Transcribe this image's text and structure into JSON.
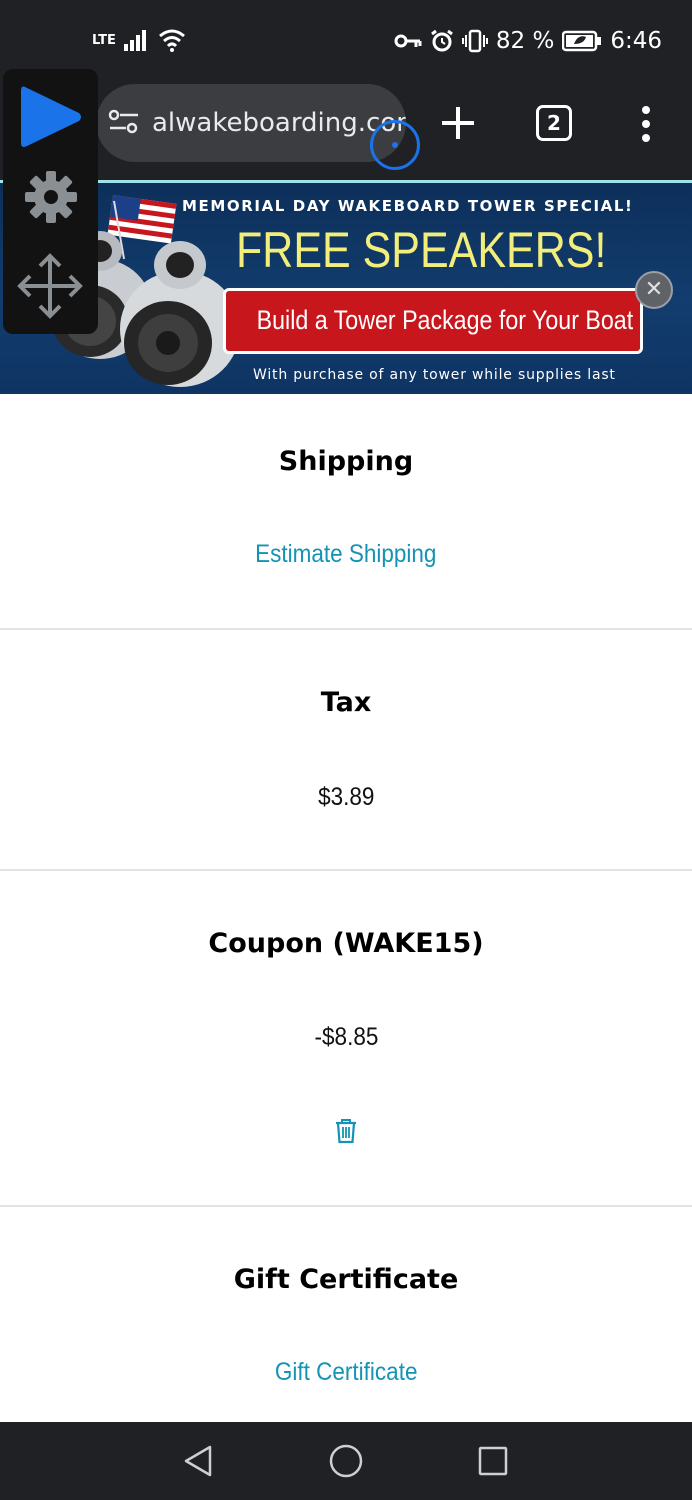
{
  "status_bar": {
    "network": "LTE",
    "battery": "82 %",
    "time": "6:46"
  },
  "browser": {
    "url": "alwakeboarding.com",
    "tab_count": "2",
    "icons": [
      "tune-icon",
      "record-indicator-icon",
      "new-tab-plus-icon",
      "tabs-icon",
      "more-vert-icon"
    ]
  },
  "overlay": {
    "icons": [
      "play-icon",
      "gear-icon",
      "move-icon"
    ]
  },
  "banner": {
    "headline": "MEMORIAL DAY WAKEBOARD TOWER SPECIAL!",
    "promo": "FREE SPEAKERS!",
    "button_label": "Build a Tower Package for Your Boat",
    "subtext": "With purchase of any tower while supplies last",
    "close_symbol": "✕"
  },
  "shipping": {
    "title": "Shipping",
    "link": "Estimate Shipping"
  },
  "tax": {
    "title": "Tax",
    "value": "$3.89"
  },
  "coupon": {
    "title": "Coupon (WAKE15)",
    "value": "-$8.85",
    "remove_icon": "trash-icon"
  },
  "gift_certificate": {
    "title": "Gift Certificate",
    "link": "Gift Certificate"
  },
  "colors": {
    "link": "#1493b6",
    "banner_bg": "#123d6e",
    "banner_promo": "#f3ee7a",
    "banner_button": "#c8161d",
    "chrome_bg": "#202124"
  }
}
